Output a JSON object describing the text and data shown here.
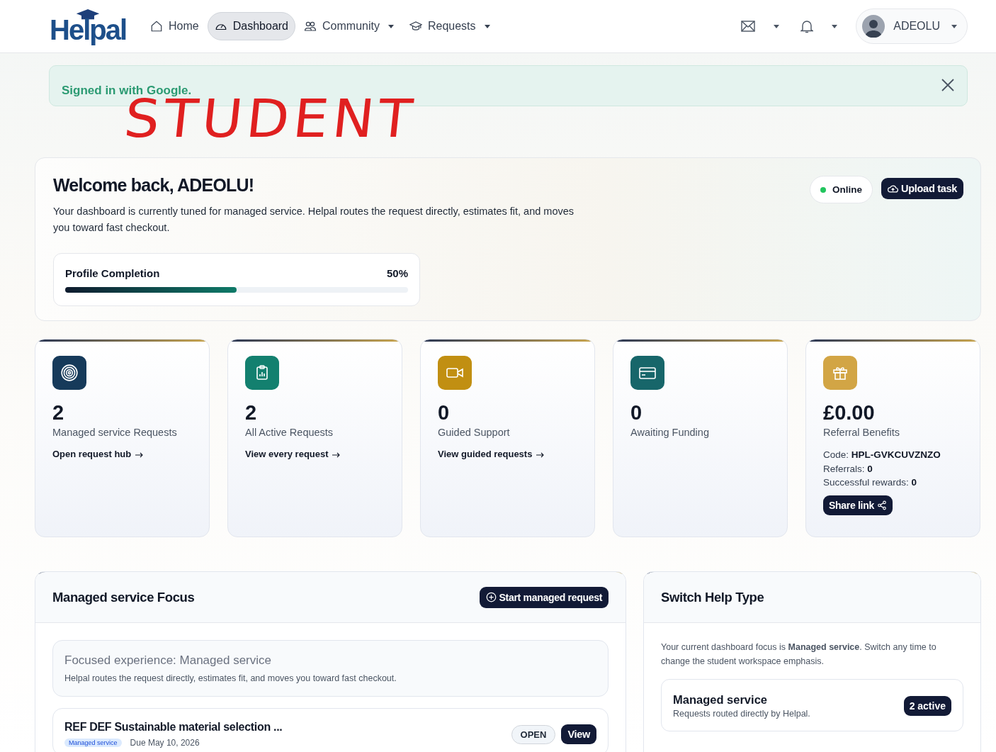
{
  "header": {
    "logo": "Helpal",
    "nav": [
      {
        "label": "Home",
        "selected": false,
        "dropdown": false
      },
      {
        "label": "Dashboard",
        "selected": true,
        "dropdown": false
      },
      {
        "label": "Community",
        "selected": false,
        "dropdown": true
      },
      {
        "label": "Requests",
        "selected": false,
        "dropdown": true
      }
    ],
    "user": {
      "name": "ADEOLU"
    }
  },
  "alert": {
    "text": "Signed in with Google."
  },
  "annotation": {
    "text": "STUDENT"
  },
  "welcome": {
    "title": "Welcome back, ADEOLU!",
    "text": "Your dashboard is currently tuned for managed service. Helpal routes the request directly, estimates fit, and moves you toward fast checkout.",
    "status": "Online",
    "upload_button": "Upload task",
    "profile": {
      "label": "Profile Completion",
      "reading": "50%",
      "level": 0.5
    }
  },
  "stats": [
    {
      "color": "#163a5a",
      "value": "2",
      "label": "Managed service Requests",
      "link": "Open request hub"
    },
    {
      "color": "#13806f",
      "value": "2",
      "label": "All Active Requests",
      "link": "View every request"
    },
    {
      "color": "#c18f12",
      "value": "0",
      "label": "Guided Support",
      "link": "View guided requests"
    },
    {
      "color": "#17666a",
      "value": "0",
      "label": "Awaiting Funding"
    },
    {
      "color": "#d2a545",
      "value": "£0.00",
      "label": "Referral Benefits",
      "details": [
        "Code: **HPL-GVKCUVZNZO**",
        "Referrals: **0**",
        "Successful rewards: **0**"
      ],
      "button": "Share link"
    }
  ],
  "focus": {
    "title": "Managed service Focus",
    "button": "Start managed request",
    "banner": {
      "title": "Focused experience: Managed service",
      "text": "Helpal routes the request directly, estimates fit, and moves you toward fast checkout."
    },
    "requests": [
      {
        "title": "REF DEF Sustainable material selection ...",
        "tag": "Managed service",
        "due": "Due May 10, 2026",
        "status": "OPEN",
        "button": "View"
      }
    ]
  },
  "switch": {
    "title": "Switch Help Type",
    "text": "Your current dashboard focus is **Managed service**. Switch any time to change the student workspace emphasis.",
    "options": [
      {
        "title": "Managed service",
        "text": "Requests routed directly by Helpal.",
        "badge": "2 active"
      }
    ]
  }
}
